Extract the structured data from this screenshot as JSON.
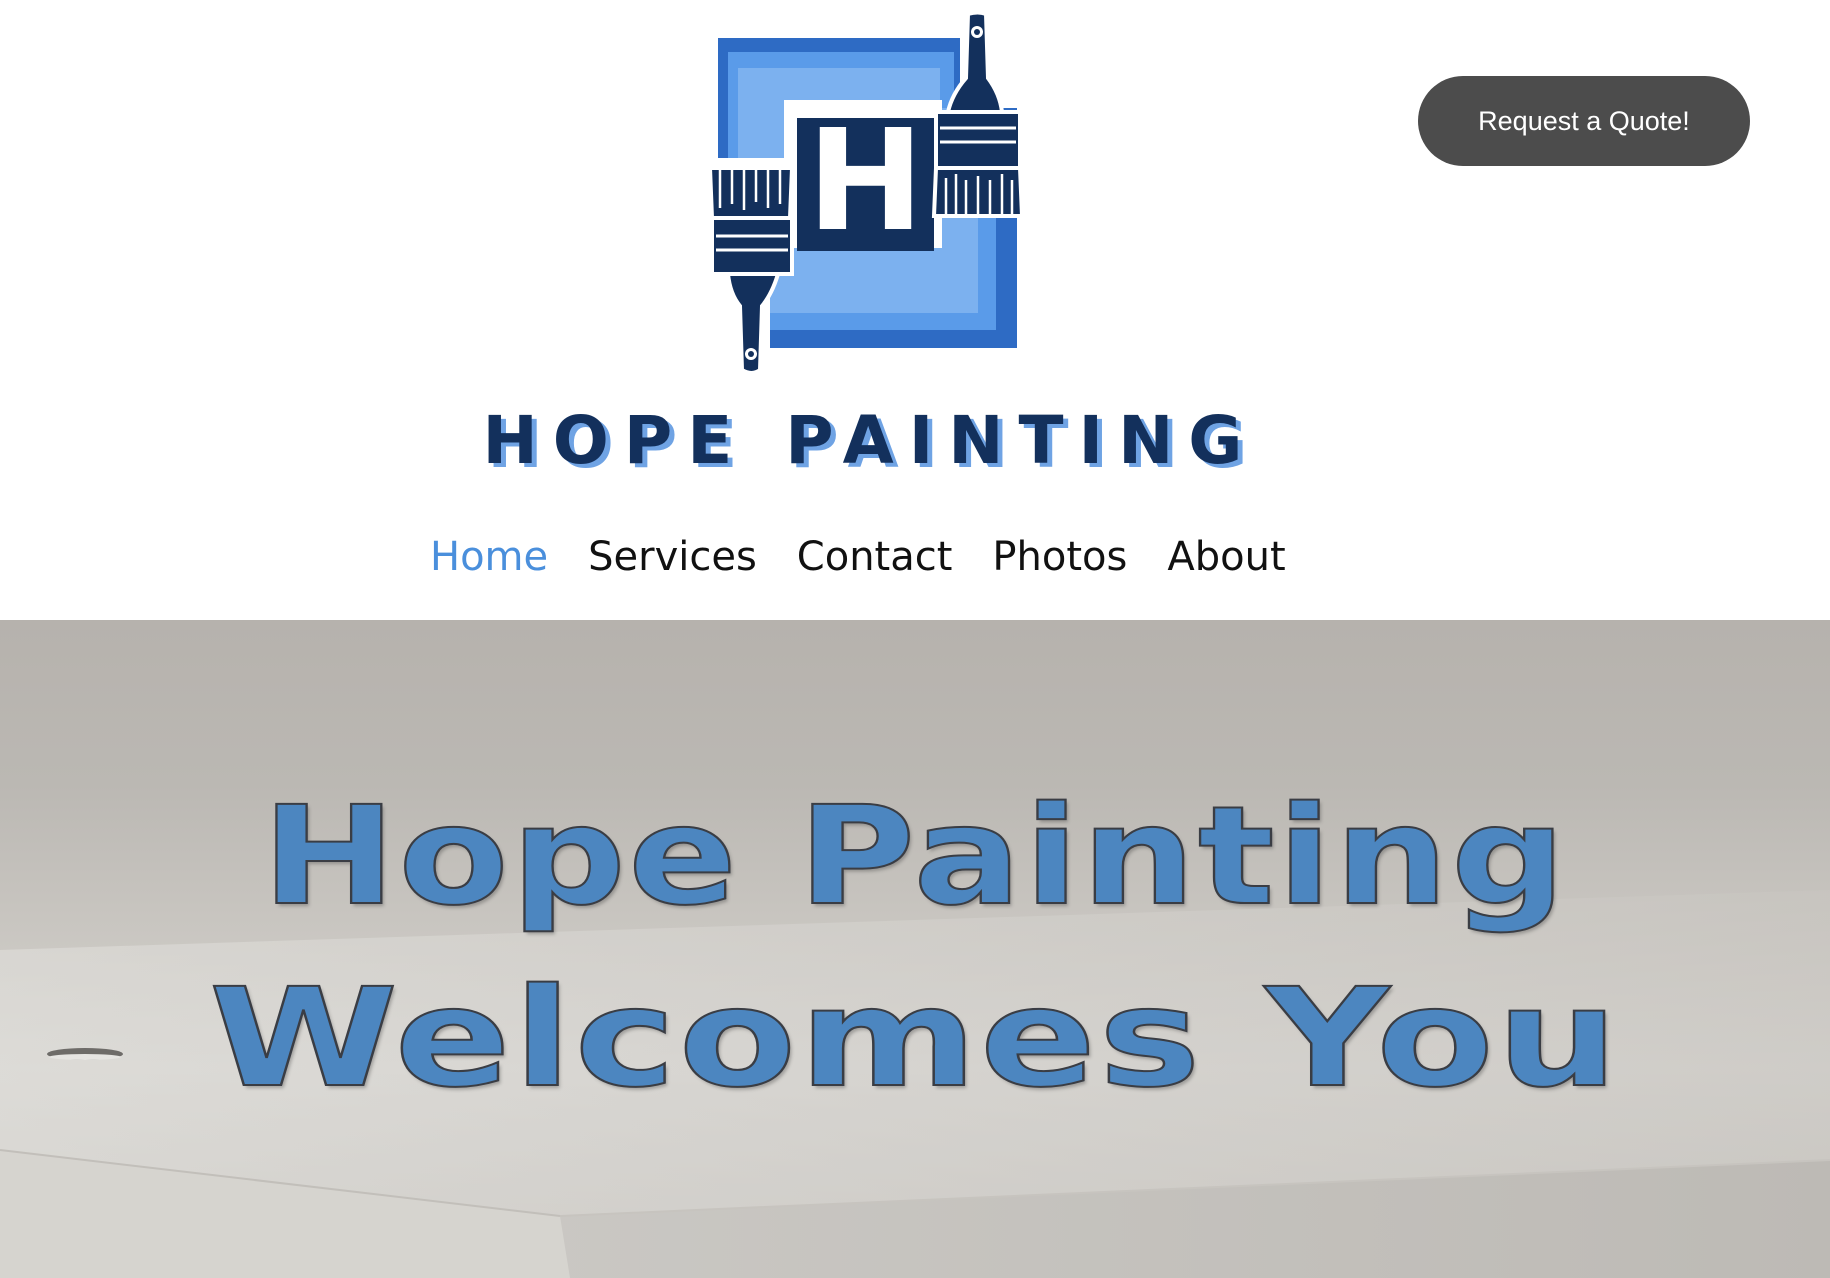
{
  "header": {
    "logo_letter": "H",
    "brand_name": "HOPE PAINTING",
    "quote_button": "Request a Quote!"
  },
  "nav": {
    "items": [
      {
        "label": "Home",
        "active": true
      },
      {
        "label": "Services",
        "active": false
      },
      {
        "label": "Contact",
        "active": false
      },
      {
        "label": "Photos",
        "active": false
      },
      {
        "label": "About",
        "active": false
      }
    ]
  },
  "hero": {
    "line1": "Hope Painting",
    "line2": "Welcomes You"
  },
  "colors": {
    "brand_navy": "#13305c",
    "brand_blue": "#2e6bc4",
    "brand_light_blue": "#6fa3e4",
    "nav_active": "#4a8fdc",
    "button_bg": "#4c4c4c",
    "hero_text": "#4c86c0"
  }
}
